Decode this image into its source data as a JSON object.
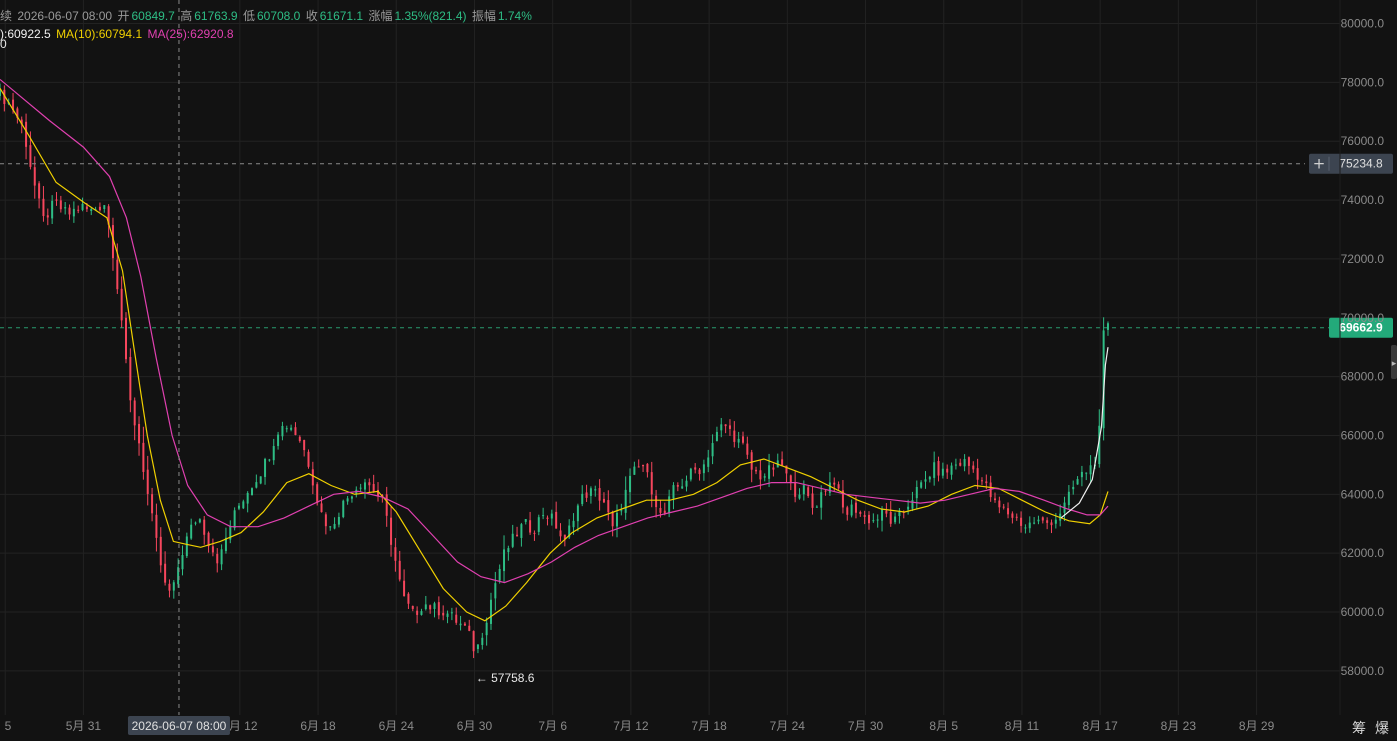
{
  "header": {
    "period_fragment": "续",
    "date": "2026-06-07 08:00",
    "open_label": "开",
    "open": "60849.7",
    "high_label": "高",
    "high": "61763.9",
    "low_label": "低",
    "low": "60708.0",
    "close_label": "收",
    "close": "61671.1",
    "change_label": "涨幅",
    "change": "1.35%(821.4)",
    "amplitude_label": "振幅",
    "amplitude": "1.74%"
  },
  "indicators": {
    "ma_a_fragment": "):60922.5",
    "ma_b_label": "MA(10):60794.1",
    "ma_c_label": "MA(25):62920.8"
  },
  "buttons": {
    "chips_label": "筹",
    "liquidation_label": "爆"
  },
  "colors": {
    "background": "#121212",
    "grid": "#222222",
    "up": "#2ebd85",
    "down": "#f6465d",
    "ma_a": "#f0f0f0",
    "ma_b": "#f0d000",
    "ma_c": "#e040b0",
    "crosshair": "#8a8a8a"
  },
  "chart_data": {
    "type": "candlestick",
    "y_axis": {
      "ticks": [
        "58000.0",
        "60000.0",
        "62000.0",
        "64000.0",
        "66000.0",
        "68000.0",
        "70000.0",
        "72000.0",
        "74000.0",
        "76000.0",
        "78000.0",
        "80000.0"
      ],
      "tick_values": [
        58000,
        60000,
        62000,
        64000,
        66000,
        68000,
        70000,
        72000,
        74000,
        76000,
        78000,
        80000
      ],
      "range": [
        56500,
        80800
      ]
    },
    "x_axis": {
      "ticks": [
        "5",
        "5月 31",
        "6月 12",
        "6月 18",
        "6月 24",
        "6月 30",
        "7月 6",
        "7月 12",
        "7月 18",
        "7月 24",
        "7月 30",
        "8月 5",
        "8月 11",
        "8月 17",
        "8月 23",
        "8月 29"
      ],
      "tick_days": [
        -6,
        0,
        12,
        18,
        24,
        30,
        36,
        42,
        48,
        54,
        60,
        66,
        72,
        78,
        84,
        90
      ],
      "range_days": [
        -6.4,
        96.4
      ]
    },
    "crosshair": {
      "x_label": "2026-06-07 08:00",
      "x_day": 7.33,
      "y_label": "75234.8",
      "y_value": 75234.8
    },
    "last_price": {
      "label": "69662.9",
      "value": 69662.9
    },
    "annotations": [
      {
        "text": "← 57758.6",
        "x_day": 30.1,
        "value": 57758.6
      },
      {
        "text": "0",
        "x_day": -6.4,
        "value": 79300
      }
    ],
    "close_path": [
      [
        -6.4,
        77600
      ],
      [
        -5.5,
        77200
      ],
      [
        -4.6,
        76400
      ],
      [
        -3.8,
        74600
      ],
      [
        -3.1,
        73300
      ],
      [
        -2.2,
        73900
      ],
      [
        -1.2,
        73500
      ],
      [
        -0.2,
        73800
      ],
      [
        0.5,
        73600
      ],
      [
        1.6,
        73900
      ],
      [
        2.1,
        72800
      ],
      [
        2.9,
        70100
      ],
      [
        3.5,
        67300
      ],
      [
        4.3,
        65700
      ],
      [
        5.0,
        63800
      ],
      [
        5.7,
        62100
      ],
      [
        6.4,
        60600
      ],
      [
        7.1,
        60900
      ],
      [
        7.3,
        61671
      ],
      [
        8.1,
        62700
      ],
      [
        8.8,
        63300
      ],
      [
        9.6,
        62400
      ],
      [
        10.4,
        61700
      ],
      [
        11.2,
        62900
      ],
      [
        11.9,
        63600
      ],
      [
        12.7,
        64200
      ],
      [
        13.5,
        64700
      ],
      [
        14.2,
        65300
      ],
      [
        14.9,
        66200
      ],
      [
        15.8,
        66400
      ],
      [
        16.7,
        65800
      ],
      [
        17.4,
        64900
      ],
      [
        18.1,
        63500
      ],
      [
        18.9,
        62800
      ],
      [
        19.8,
        63600
      ],
      [
        20.6,
        64100
      ],
      [
        21.5,
        64500
      ],
      [
        22.2,
        64200
      ],
      [
        23.0,
        63700
      ],
      [
        23.9,
        61800
      ],
      [
        24.5,
        60500
      ],
      [
        25.3,
        59900
      ],
      [
        26.1,
        60300
      ],
      [
        27.0,
        60100
      ],
      [
        27.8,
        60000
      ],
      [
        28.6,
        59700
      ],
      [
        29.4,
        59400
      ],
      [
        30.1,
        58600
      ],
      [
        30.8,
        59600
      ],
      [
        31.6,
        61000
      ],
      [
        32.3,
        62000
      ],
      [
        33.0,
        62500
      ],
      [
        33.8,
        63000
      ],
      [
        34.5,
        62800
      ],
      [
        35.3,
        63400
      ],
      [
        36.1,
        63100
      ],
      [
        36.9,
        62300
      ],
      [
        37.6,
        63300
      ],
      [
        38.4,
        64000
      ],
      [
        39.1,
        64100
      ],
      [
        39.9,
        63800
      ],
      [
        40.6,
        62800
      ],
      [
        41.4,
        63800
      ],
      [
        42.1,
        64700
      ],
      [
        42.9,
        65000
      ],
      [
        43.6,
        64200
      ],
      [
        44.4,
        63100
      ],
      [
        45.2,
        64100
      ],
      [
        46.0,
        64400
      ],
      [
        46.8,
        64800
      ],
      [
        47.5,
        64900
      ],
      [
        48.3,
        65800
      ],
      [
        49.1,
        66400
      ],
      [
        49.9,
        66000
      ],
      [
        50.6,
        65600
      ],
      [
        51.3,
        64800
      ],
      [
        52.1,
        64600
      ],
      [
        52.9,
        64900
      ],
      [
        53.6,
        65000
      ],
      [
        54.4,
        64100
      ],
      [
        55.2,
        64200
      ],
      [
        56.0,
        63500
      ],
      [
        56.8,
        64200
      ],
      [
        57.6,
        64500
      ],
      [
        58.4,
        63300
      ],
      [
        59.1,
        63600
      ],
      [
        59.9,
        63200
      ],
      [
        60.7,
        63100
      ],
      [
        61.4,
        63400
      ],
      [
        62.1,
        63000
      ],
      [
        62.9,
        63400
      ],
      [
        63.7,
        64000
      ],
      [
        64.5,
        64400
      ],
      [
        65.2,
        64900
      ],
      [
        66.0,
        64700
      ],
      [
        66.8,
        65000
      ],
      [
        67.6,
        65100
      ],
      [
        68.4,
        64800
      ],
      [
        69.2,
        64300
      ],
      [
        70.0,
        63600
      ],
      [
        70.8,
        63400
      ],
      [
        71.5,
        63200
      ],
      [
        72.3,
        62900
      ],
      [
        73.0,
        63100
      ],
      [
        73.8,
        63000
      ],
      [
        74.6,
        63200
      ],
      [
        75.4,
        63700
      ],
      [
        76.1,
        64400
      ],
      [
        76.9,
        64800
      ],
      [
        77.5,
        65000
      ],
      [
        77.9,
        65800
      ],
      [
        78.3,
        69700
      ],
      [
        78.6,
        69662.9
      ]
    ],
    "series": [
      {
        "name": "MA(10)",
        "color": "#f0d000",
        "values": [
          [
            -6.4,
            77800
          ],
          [
            -4.2,
            76200
          ],
          [
            -2.1,
            74600
          ],
          [
            0.1,
            73900
          ],
          [
            1.8,
            73400
          ],
          [
            3.0,
            71600
          ],
          [
            3.9,
            68900
          ],
          [
            4.9,
            66000
          ],
          [
            5.9,
            63800
          ],
          [
            6.9,
            62400
          ],
          [
            7.9,
            62300
          ],
          [
            9.0,
            62200
          ],
          [
            10.5,
            62400
          ],
          [
            12.1,
            62700
          ],
          [
            13.8,
            63400
          ],
          [
            15.6,
            64400
          ],
          [
            17.3,
            64700
          ],
          [
            19.0,
            64300
          ],
          [
            20.8,
            64000
          ],
          [
            22.6,
            64100
          ],
          [
            24.0,
            63400
          ],
          [
            25.8,
            62100
          ],
          [
            27.6,
            60800
          ],
          [
            29.4,
            60000
          ],
          [
            30.8,
            59700
          ],
          [
            32.4,
            60200
          ],
          [
            34.0,
            61000
          ],
          [
            35.8,
            62000
          ],
          [
            37.5,
            62700
          ],
          [
            39.4,
            63200
          ],
          [
            41.3,
            63500
          ],
          [
            43.2,
            63800
          ],
          [
            45.0,
            63800
          ],
          [
            46.8,
            64000
          ],
          [
            48.6,
            64400
          ],
          [
            50.4,
            65000
          ],
          [
            52.2,
            65200
          ],
          [
            54.0,
            64900
          ],
          [
            55.8,
            64600
          ],
          [
            57.6,
            64200
          ],
          [
            59.4,
            63800
          ],
          [
            61.2,
            63500
          ],
          [
            63.0,
            63400
          ],
          [
            64.8,
            63600
          ],
          [
            66.6,
            64000
          ],
          [
            68.4,
            64300
          ],
          [
            70.2,
            64200
          ],
          [
            72.0,
            63800
          ],
          [
            73.8,
            63400
          ],
          [
            75.6,
            63100
          ],
          [
            77.2,
            63000
          ],
          [
            78.0,
            63300
          ],
          [
            78.6,
            64100
          ]
        ]
      },
      {
        "name": "MA(25)",
        "color": "#e040b0",
        "values": [
          [
            -6.4,
            78100
          ],
          [
            -2.6,
            76700
          ],
          [
            0.0,
            75800
          ],
          [
            2.0,
            74800
          ],
          [
            3.3,
            73400
          ],
          [
            4.4,
            71400
          ],
          [
            5.6,
            68600
          ],
          [
            6.8,
            66000
          ],
          [
            8.0,
            64300
          ],
          [
            9.5,
            63300
          ],
          [
            11.3,
            62900
          ],
          [
            13.4,
            62900
          ],
          [
            15.4,
            63200
          ],
          [
            17.3,
            63600
          ],
          [
            19.2,
            64000
          ],
          [
            21.1,
            64100
          ],
          [
            23.0,
            63900
          ],
          [
            24.9,
            63500
          ],
          [
            26.8,
            62600
          ],
          [
            28.7,
            61700
          ],
          [
            30.5,
            61200
          ],
          [
            32.3,
            61000
          ],
          [
            34.1,
            61300
          ],
          [
            35.9,
            61700
          ],
          [
            37.7,
            62200
          ],
          [
            39.5,
            62600
          ],
          [
            41.4,
            62900
          ],
          [
            43.3,
            63200
          ],
          [
            45.2,
            63400
          ],
          [
            47.1,
            63600
          ],
          [
            49.0,
            63900
          ],
          [
            50.9,
            64200
          ],
          [
            52.8,
            64400
          ],
          [
            54.7,
            64400
          ],
          [
            56.6,
            64200
          ],
          [
            58.5,
            64000
          ],
          [
            60.4,
            63900
          ],
          [
            62.3,
            63800
          ],
          [
            64.2,
            63700
          ],
          [
            66.1,
            63800
          ],
          [
            68.0,
            64000
          ],
          [
            69.9,
            64200
          ],
          [
            71.8,
            64100
          ],
          [
            73.7,
            63800
          ],
          [
            75.5,
            63500
          ],
          [
            77.0,
            63300
          ],
          [
            78.0,
            63300
          ],
          [
            78.6,
            63600
          ]
        ]
      },
      {
        "name": "MA(a)",
        "color": "#f0f0f0",
        "values": [
          [
            75.0,
            63200
          ],
          [
            76.4,
            63700
          ],
          [
            77.4,
            64500
          ],
          [
            78.1,
            66300
          ],
          [
            78.4,
            68400
          ],
          [
            78.6,
            69000
          ]
        ]
      }
    ]
  }
}
